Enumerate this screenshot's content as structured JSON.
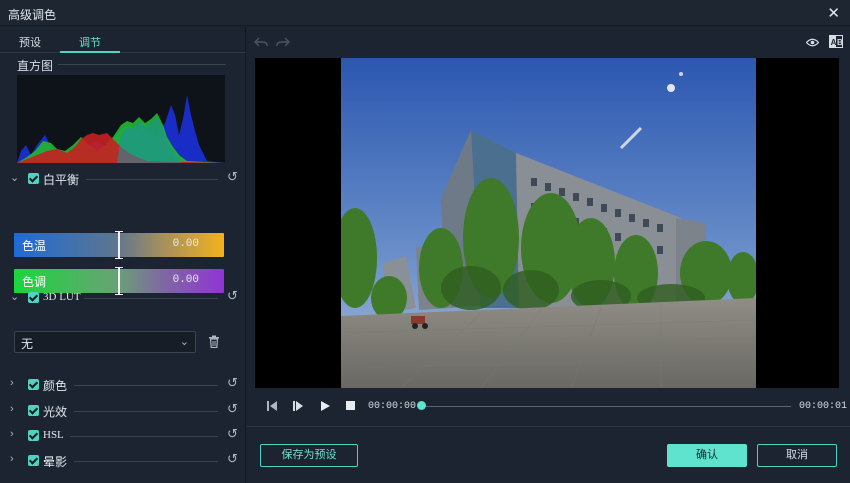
{
  "window": {
    "title": "高级调色"
  },
  "tabs": [
    {
      "label": "预设"
    },
    {
      "label": "调节"
    }
  ],
  "histogram": {
    "label": "直方图"
  },
  "white_balance": {
    "label": "白平衡",
    "checked": true,
    "temperature": {
      "label": "色温",
      "value": "0.00"
    },
    "tint": {
      "label": "色调",
      "value": "0.00"
    }
  },
  "lut": {
    "label": "3D LUT",
    "checked": true,
    "dropdown": {
      "selected": "无"
    }
  },
  "sections": [
    {
      "label": "颜色",
      "checked": true
    },
    {
      "label": "光效",
      "checked": true
    },
    {
      "label": "HSL",
      "checked": true
    },
    {
      "label": "晕影",
      "checked": true
    }
  ],
  "playback": {
    "current_time": "00:00:00",
    "total_time": "00:00:01",
    "progress": 0
  },
  "buttons": {
    "save_preset": "保存为预设",
    "confirm": "确认",
    "cancel": "取消"
  },
  "colors": {
    "accent": "#4fd2bf",
    "background": "#1c2431"
  },
  "icons": [
    "undo-icon",
    "redo-icon",
    "eye-icon",
    "ab-compare-icon",
    "chevron-down-icon",
    "reset-icon",
    "trash-icon",
    "prev-frame-icon",
    "next-frame-icon",
    "play-icon",
    "stop-icon",
    "close-icon"
  ]
}
